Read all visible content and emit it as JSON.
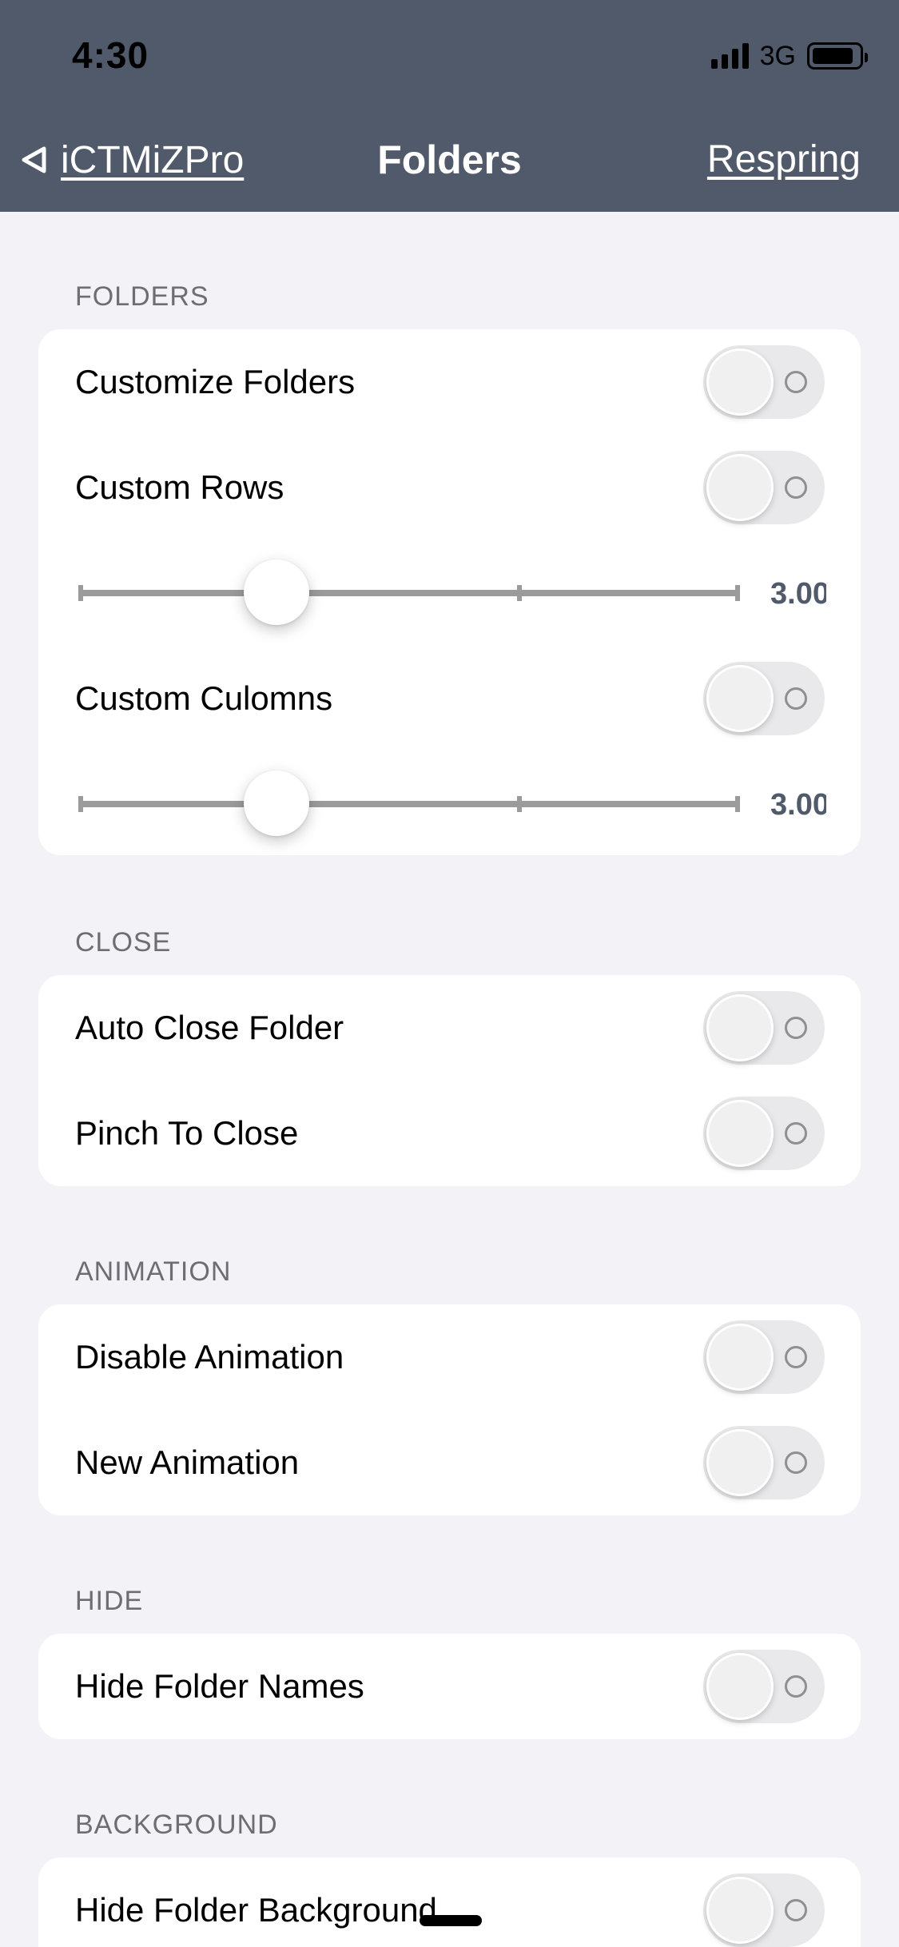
{
  "status_bar": {
    "time": "4:30",
    "network": "3G",
    "icons": [
      "signal-bars-icon",
      "battery-icon"
    ]
  },
  "nav": {
    "back_label": "iCTMiZPro",
    "back_icon": "back-triangle-icon",
    "title": "Folders",
    "action_label": "Respring"
  },
  "colors": {
    "nav_background": "#505a6b",
    "page_background": "#f2f2f7",
    "slider_value_text": "#505a6b"
  },
  "sections": {
    "folders": {
      "header": "FOLDERS",
      "customize_folders": {
        "label": "Customize Folders",
        "on": false
      },
      "custom_rows": {
        "label": "Custom Rows",
        "on": false
      },
      "rows_slider": {
        "value_text": "3.00",
        "value": 3,
        "fraction": 0.3
      },
      "custom_columns": {
        "label": "Custom Culomns",
        "on": false
      },
      "columns_slider": {
        "value_text": "3.00",
        "value": 3,
        "fraction": 0.3
      }
    },
    "close": {
      "header": "CLOSE",
      "auto_close": {
        "label": "Auto Close Folder",
        "on": false
      },
      "pinch_to_close": {
        "label": "Pinch To Close",
        "on": false
      }
    },
    "animation": {
      "header": "ANIMATION",
      "disable_animation": {
        "label": "Disable Animation",
        "on": false
      },
      "new_animation": {
        "label": "New Animation",
        "on": false
      }
    },
    "hide": {
      "header": "HIDE",
      "hide_folder_names": {
        "label": "Hide Folder Names",
        "on": false
      }
    },
    "background": {
      "header": "BACKGROUND",
      "hide_folder_background": {
        "label": "Hide Folder Background",
        "on": false
      }
    }
  }
}
